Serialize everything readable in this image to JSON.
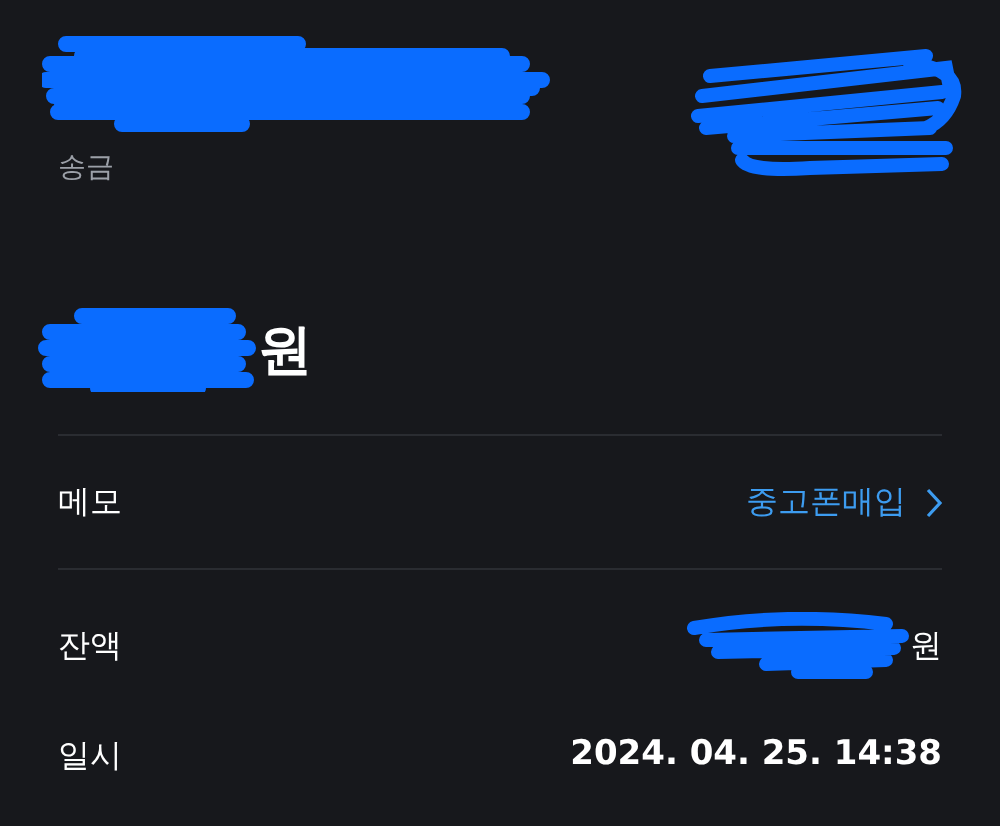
{
  "header": {
    "type": "송금"
  },
  "amount": "원",
  "details": [
    {
      "label": "메모",
      "value": "중고폰매입",
      "kind": "link"
    },
    {
      "label": "잔액",
      "value": "원",
      "kind": "redacted"
    },
    {
      "label": "일시",
      "value": "2024. 04. 25. 14:38",
      "kind": "text"
    }
  ]
}
